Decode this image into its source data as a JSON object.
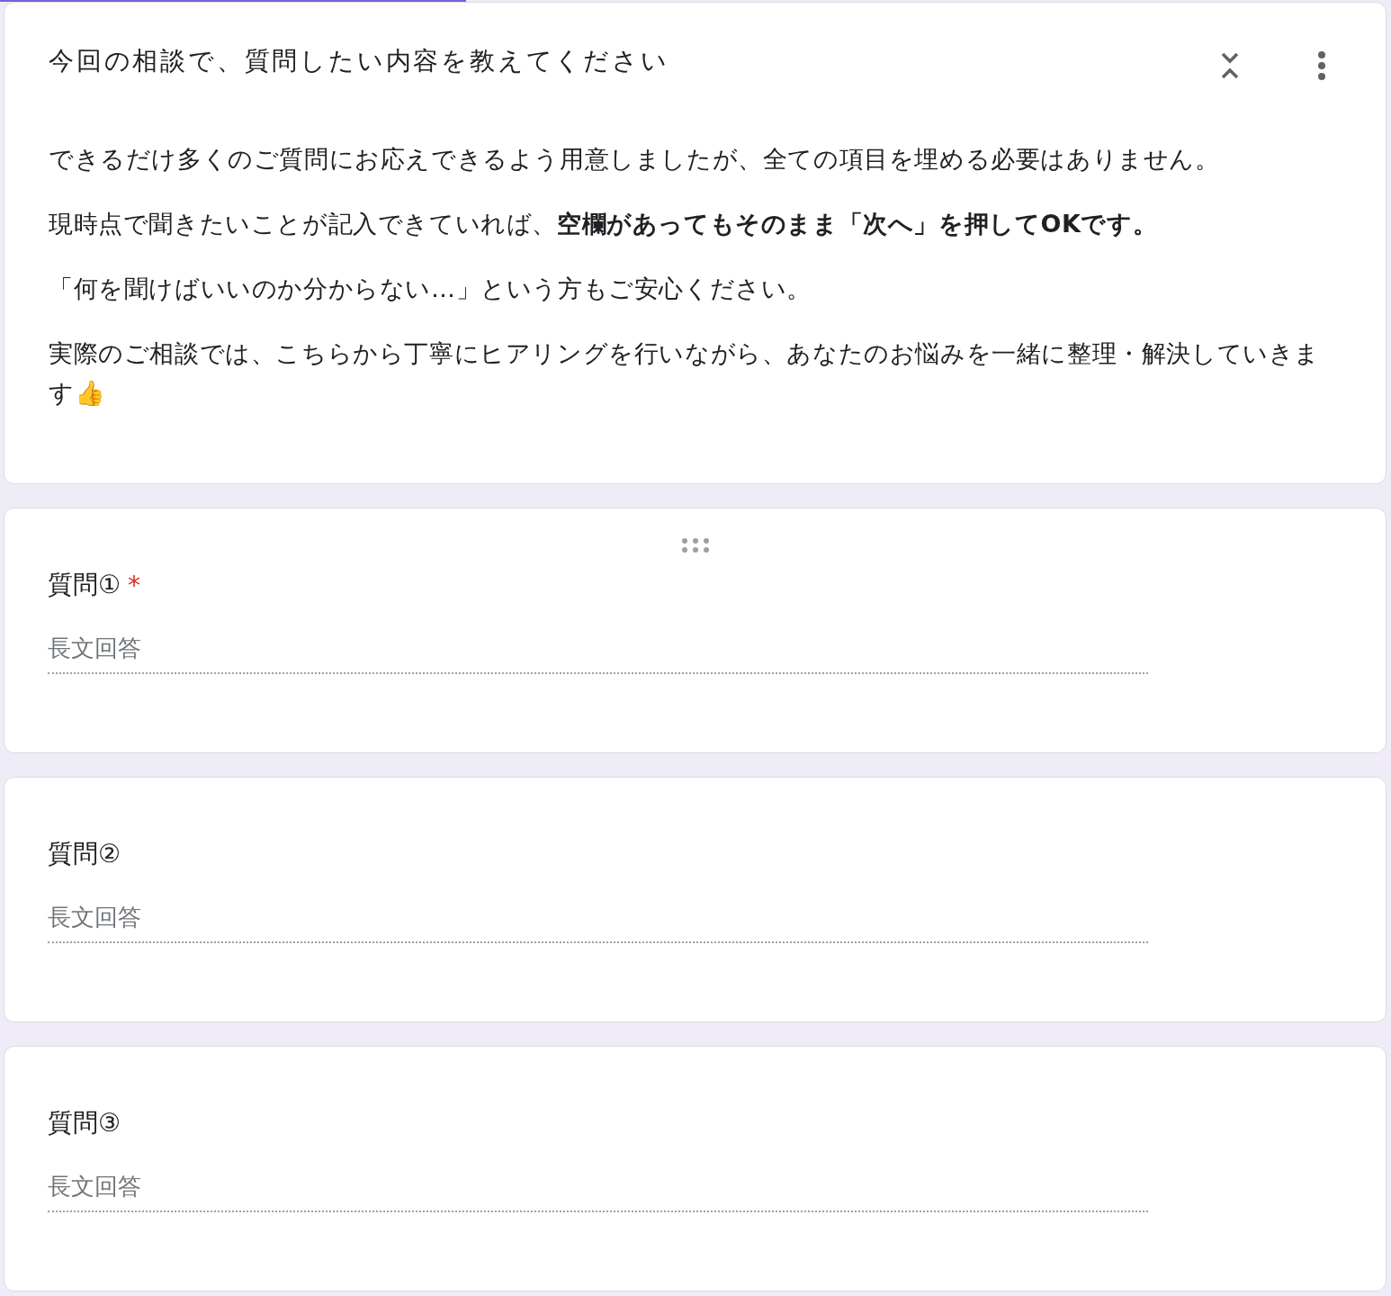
{
  "progress": {
    "level": 0.335
  },
  "section": {
    "title": "今回の相談で、質問したい内容を教えてください",
    "paragraphs": [
      "できるだけ多くのご質問にお応えできるよう用意しましたが、全ての項目を埋める必要はありません。",
      "現時点で聞きたいことが記入できていれば、**空欄があってもそのまま「次へ」を押してOKです。**",
      "「何を聞けばいいのか分からない…」という方もご安心ください。",
      "実際のご相談では、こちらから丁寧にヒアリングを行いながら、あなたのお悩みを一緒に整理・解決していきます👍"
    ]
  },
  "questions": [
    {
      "title": "質問①",
      "required_mark": "*",
      "focused": true,
      "placeholder": "長文回答"
    },
    {
      "title": "質問②",
      "focused": false,
      "placeholder": "長文回答"
    },
    {
      "title": "質問③",
      "focused": false,
      "placeholder": "長文回答"
    }
  ]
}
